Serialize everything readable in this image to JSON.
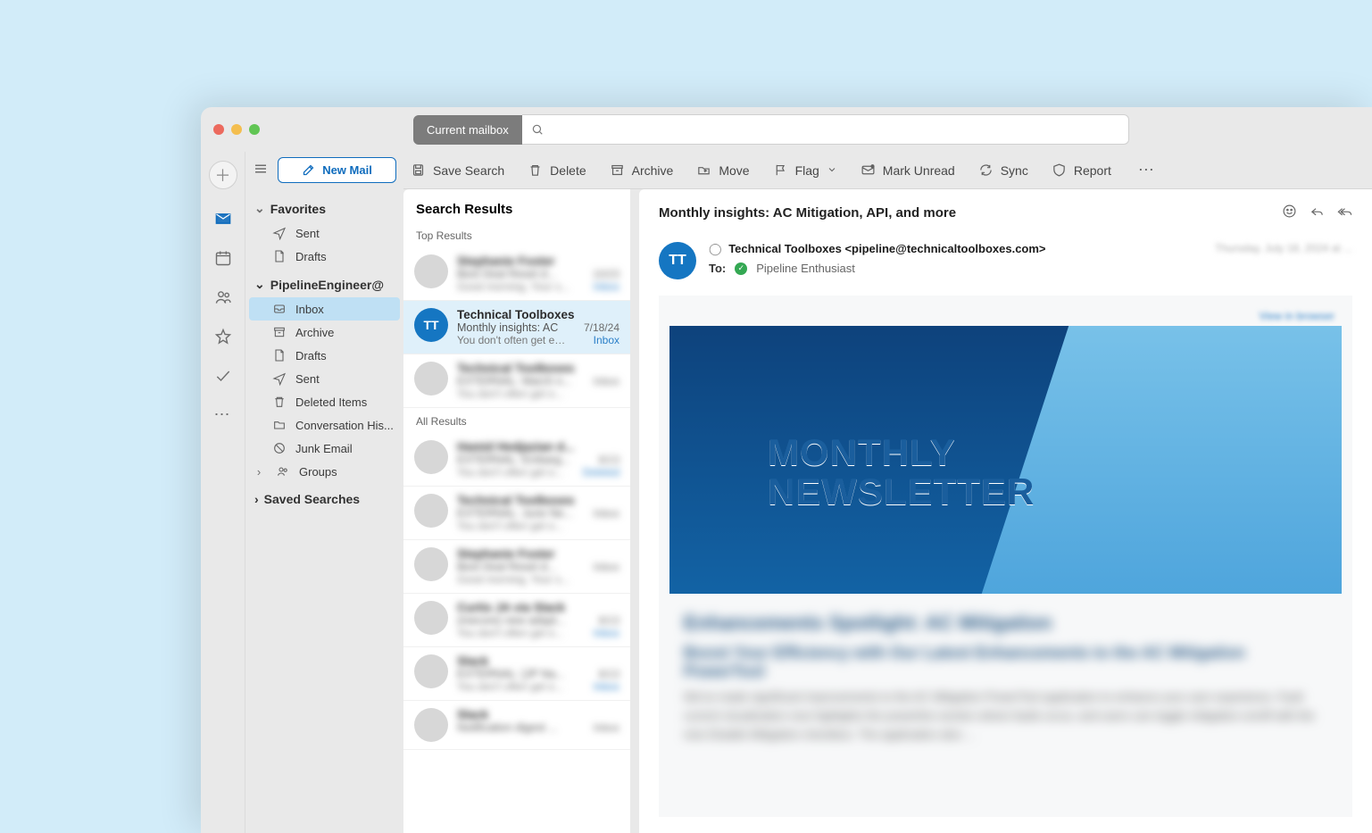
{
  "search": {
    "scope_label": "Current mailbox",
    "placeholder": ""
  },
  "toolbar": {
    "save_search": "Save Search",
    "delete": "Delete",
    "archive": "Archive",
    "move": "Move",
    "flag": "Flag",
    "mark_unread": "Mark Unread",
    "sync": "Sync",
    "report": "Report"
  },
  "compose": {
    "new_mail": "New Mail"
  },
  "sidebar": {
    "favorites_label": "Favorites",
    "favorites": [
      {
        "label": "Sent",
        "icon": "paper-plane"
      },
      {
        "label": "Drafts",
        "icon": "draft"
      }
    ],
    "account_label": "PipelineEngineer@",
    "account_folders": [
      {
        "label": "Inbox",
        "icon": "inbox",
        "selected": true
      },
      {
        "label": "Archive",
        "icon": "archive"
      },
      {
        "label": "Drafts",
        "icon": "draft"
      },
      {
        "label": "Sent",
        "icon": "paper-plane"
      },
      {
        "label": "Deleted Items",
        "icon": "trash"
      },
      {
        "label": "Conversation His...",
        "icon": "folder"
      },
      {
        "label": "Junk Email",
        "icon": "junk"
      },
      {
        "label": "Groups",
        "icon": "groups",
        "chevron": true
      }
    ],
    "saved_searches_label": "Saved Searches"
  },
  "list": {
    "title": "Search Results",
    "top_results_label": "Top Results",
    "all_results_label": "All Results",
    "selected": {
      "sender": "Technical Toolboxes",
      "subject": "Monthly insights: AC",
      "preview": "You don't often get e…",
      "date": "7/18/24",
      "source": "Inbox",
      "avatar_initials": "TT"
    }
  },
  "reader": {
    "subject": "Monthly insights: AC Mitigation, API, and more",
    "from_display": "Technical Toolboxes <pipeline@technicaltoolboxes.com>",
    "to_label": "To:",
    "to_name": "Pipeline Enthusiast",
    "date_blurred": "Thursday, July 18, 2024 at ...",
    "view_in_browser": "View in browser",
    "hero_line1": "MONTHLY",
    "hero_line2": "NEWSLETTER",
    "article_h2": "Enhancements Spotlight: AC Mitigation",
    "article_h3": "Boost Your Efficiency with Our Latest Enhancements to the AC Mitigation PowerTool",
    "article_p": "We've made significant improvements to the AC Mitigation PowerTool application to enhance your user experience. Fault current visualization now highlights the powerline section where faults occur, and users can toggle mitigation on/off with the new Disable Mitigation checkbox. The application also ..."
  }
}
